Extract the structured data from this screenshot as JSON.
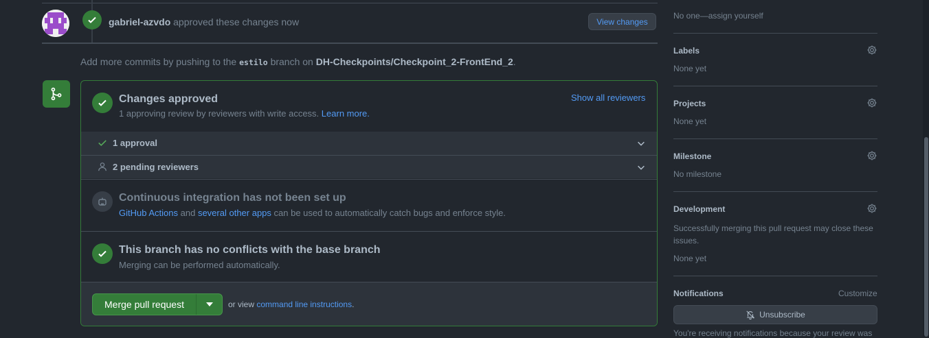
{
  "timeline": {
    "user": "gabriel-azvdo",
    "action": "approved these changes now",
    "view_changes": "View changes"
  },
  "commit_hint": {
    "prefix": "Add more commits by pushing to the",
    "branch": "estilo",
    "middle": "branch on",
    "repo": "DH-Checkpoints/Checkpoint_2-FrontEnd_2",
    "suffix": "."
  },
  "merge_box": {
    "approved_title": "Changes approved",
    "approved_sub": "1 approving review by reviewers with write access.",
    "learn_more": "Learn more.",
    "show_all": "Show all reviewers",
    "approval_row": "1 approval",
    "pending_row": "2 pending reviewers",
    "ci_title": "Continuous integration has not been set up",
    "ci_link1": "GitHub Actions",
    "ci_and": "and",
    "ci_link2": "several other apps",
    "ci_rest": "can be used to automatically catch bugs and enforce style.",
    "conflict_title": "This branch has no conflicts with the base branch",
    "conflict_sub": "Merging can be performed automatically.",
    "merge_button": "Merge pull request",
    "or_view": "or view",
    "cli_link": "command line instructions",
    "cli_end": "."
  },
  "sidebar": {
    "assignees_value": "No one—assign yourself",
    "labels": {
      "title": "Labels",
      "value": "None yet"
    },
    "projects": {
      "title": "Projects",
      "value": "None yet"
    },
    "milestone": {
      "title": "Milestone",
      "value": "No milestone"
    },
    "development": {
      "title": "Development",
      "desc": "Successfully merging this pull request may close these issues.",
      "value": "None yet"
    },
    "notifications": {
      "title": "Notifications",
      "customize": "Customize",
      "unsubscribe": "Unsubscribe",
      "footer": "You're receiving notifications because your review was"
    }
  },
  "colors": {
    "background": "#22272e",
    "accent_green": "#347d39",
    "link": "#539bf5"
  }
}
